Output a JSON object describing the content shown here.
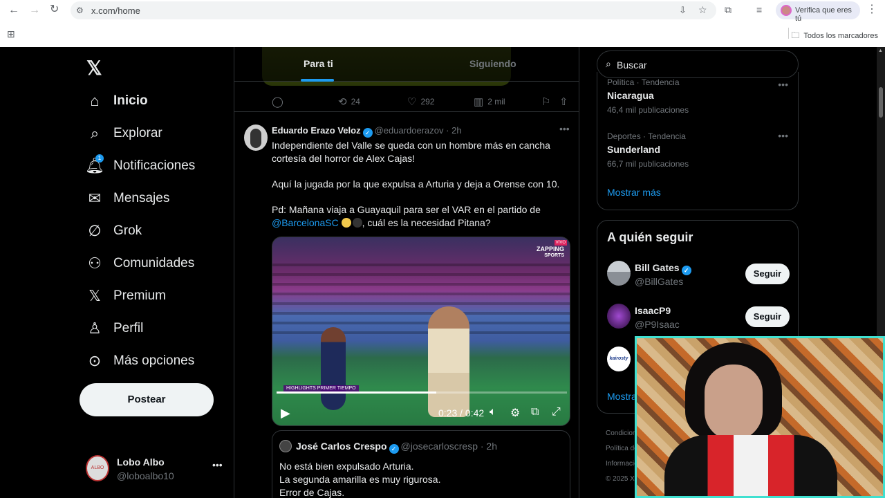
{
  "browser": {
    "url": "x.com/home",
    "verify_label": "Verifica que eres tú",
    "bookmarks_label": "Todos los marcadores"
  },
  "nav": {
    "items": [
      {
        "label": "Inicio",
        "icon": "home-icon"
      },
      {
        "label": "Explorar",
        "icon": "search-icon"
      },
      {
        "label": "Notificaciones",
        "icon": "bell-icon",
        "badge": "1"
      },
      {
        "label": "Mensajes",
        "icon": "mail-icon"
      },
      {
        "label": "Grok",
        "icon": "grok-icon"
      },
      {
        "label": "Comunidades",
        "icon": "communities-icon"
      },
      {
        "label": "Premium",
        "icon": "x-logo-icon"
      },
      {
        "label": "Perfil",
        "icon": "person-icon"
      },
      {
        "label": "Más opciones",
        "icon": "more-circle-icon"
      }
    ],
    "post_label": "Postear",
    "user": {
      "name": "Lobo Albo",
      "handle": "@loboalbo10",
      "avatar_text": "ALBO"
    }
  },
  "timeline": {
    "tabs": [
      {
        "label": "Para ti",
        "active": true
      },
      {
        "label": "Siguiendo",
        "active": false
      }
    ],
    "prev_actions": {
      "replies": "",
      "reposts": "24",
      "likes": "292",
      "views": "2 mil"
    },
    "tweet": {
      "name": "Eduardo Erazo Veloz",
      "handle": "@eduardoerazov",
      "time": "· 2h",
      "p1": "Independiente del Valle se queda con un hombre más en cancha cortesía del horror de Alex Cajas!",
      "p2": "Aquí la jugada por la que expulsa a Arturia y deja a Orense con 10.",
      "p3a": "Pd: Mañana viaja a Guayaquil para ser el VAR en el partido de ",
      "p3link": "@BarcelonaSC",
      "p3b": ", cuál es la necesidad Pitana?",
      "video": {
        "brand_top": "ZAPPING",
        "brand_bottom": "SPORTS",
        "live": "VIVO",
        "overlay": "HIGHLIGHTS PRIMER TIEMPO",
        "time": "0:23 / 0:42",
        "progress": 0.55
      },
      "quote": {
        "name": "José Carlos Crespo",
        "handle": "@josecarloscresp",
        "time": "· 2h",
        "lines": [
          "No está bien expulsado Arturia.",
          "La segunda amarilla es muy rigurosa.",
          "Error de Cajas."
        ]
      }
    }
  },
  "sidebar": {
    "search_placeholder": "Buscar",
    "trends": [
      {
        "category": "Política · Tendencia",
        "name": "Nicaragua",
        "count": "46,4 mil publicaciones"
      },
      {
        "category": "Deportes · Tendencia",
        "name": "Sunderland",
        "count": "66,7 mil publicaciones"
      }
    ],
    "show_more": "Mostrar más",
    "who_to_follow": {
      "title": "A quién seguir",
      "items": [
        {
          "name": "Bill Gates",
          "handle": "@BillGates",
          "verified": true,
          "button": "Seguir"
        },
        {
          "name": "IsaacP9",
          "handle": "@P9Isaac",
          "verified": false,
          "button": "Seguir"
        }
      ],
      "third_avatar_text": "kairosty",
      "show_more": "Mostra"
    },
    "footer": [
      "Condicion",
      "Política de",
      "Informació",
      "© 2025 X"
    ]
  },
  "colors": {
    "accent": "#1d9bf0",
    "background": "#000000",
    "webcam_border": "#40e0d0"
  }
}
